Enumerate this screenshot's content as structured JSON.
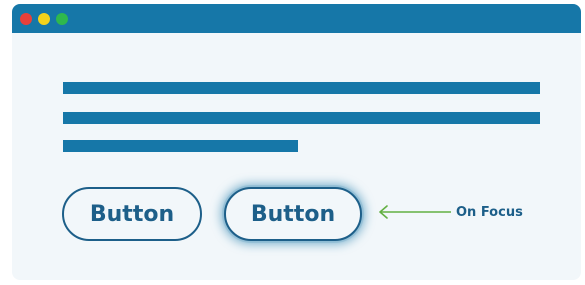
{
  "window": {
    "traffic_lights": [
      {
        "name": "close",
        "color": "#e8403a"
      },
      {
        "name": "minimize",
        "color": "#f4d21b"
      },
      {
        "name": "maximize",
        "color": "#2fb84d"
      }
    ]
  },
  "colors": {
    "accent": "#1677a8",
    "button_text": "#1d5f89",
    "arrow": "#63b043",
    "background": "#f2f7fa"
  },
  "buttons": {
    "normal_label": "Button",
    "focused_label": "Button"
  },
  "annotation": {
    "label": "On Focus",
    "icon": "arrow-left-icon"
  }
}
